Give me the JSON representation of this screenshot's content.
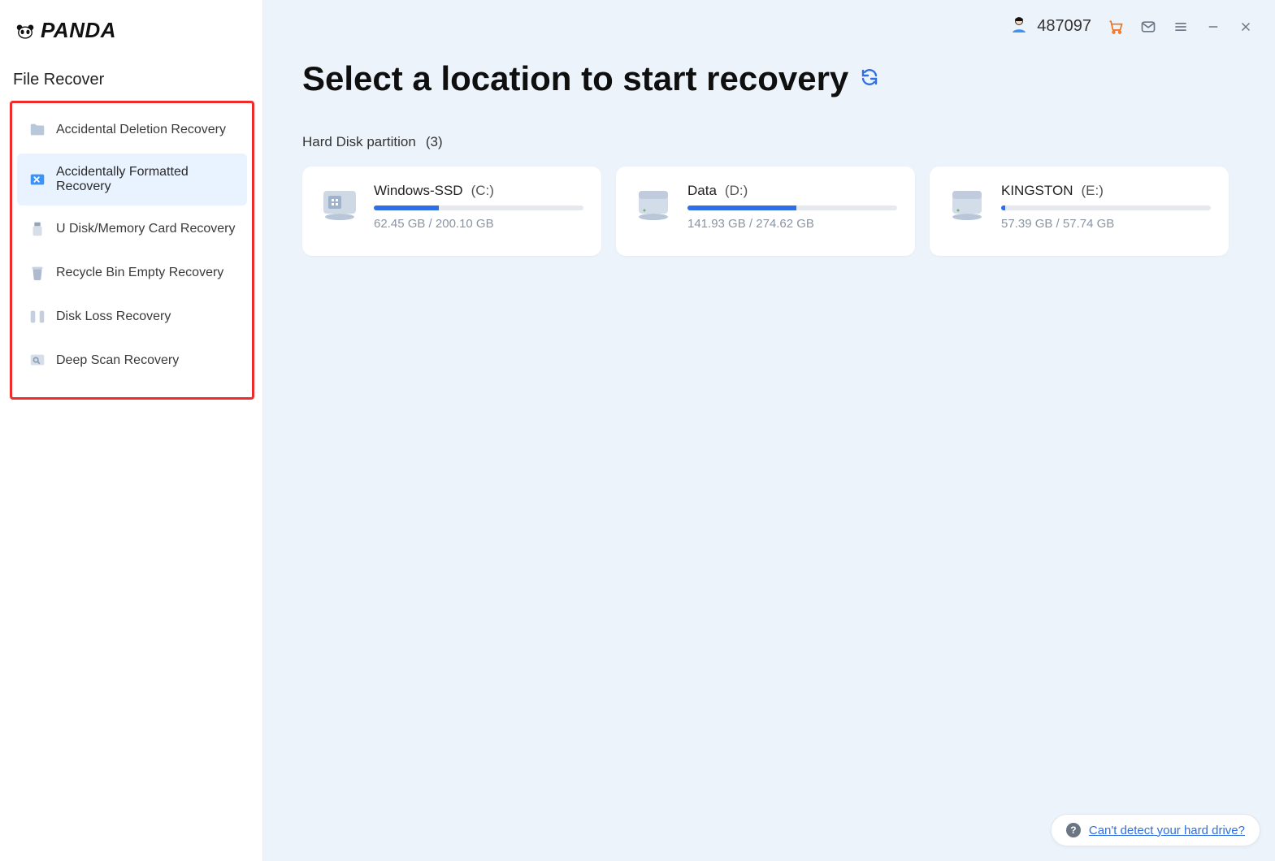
{
  "brand": "PANDA",
  "sidebar": {
    "section": "File Recover",
    "items": [
      {
        "label": "Accidental Deletion Recovery",
        "icon": "folder-icon",
        "active": false
      },
      {
        "label": "Accidentally Formatted Recovery",
        "icon": "format-icon",
        "active": true
      },
      {
        "label": "U Disk/Memory Card Recovery",
        "icon": "usb-icon",
        "active": false
      },
      {
        "label": "Recycle Bin Empty Recovery",
        "icon": "trash-icon",
        "active": false
      },
      {
        "label": "Disk Loss Recovery",
        "icon": "diskloss-icon",
        "active": false
      },
      {
        "label": "Deep Scan Recovery",
        "icon": "deepscan-icon",
        "active": false
      }
    ]
  },
  "top": {
    "user_id": "487097"
  },
  "main": {
    "title": "Select a location to start recovery",
    "partition_label": "Hard Disk partition",
    "partition_count": "(3)",
    "drives": [
      {
        "name": "Windows-SSD",
        "letter": "(C:)",
        "used": "62.45 GB",
        "total": "200.10 GB",
        "percent": 31,
        "kind": "system"
      },
      {
        "name": "Data",
        "letter": "(D:)",
        "used": "141.93 GB",
        "total": "274.62 GB",
        "percent": 52,
        "kind": "hdd"
      },
      {
        "name": "KINGSTON",
        "letter": "(E:)",
        "used": "57.39 GB",
        "total": "57.74 GB",
        "percent": 2,
        "kind": "hdd"
      }
    ]
  },
  "help": {
    "text": "Can't detect your hard drive?"
  }
}
